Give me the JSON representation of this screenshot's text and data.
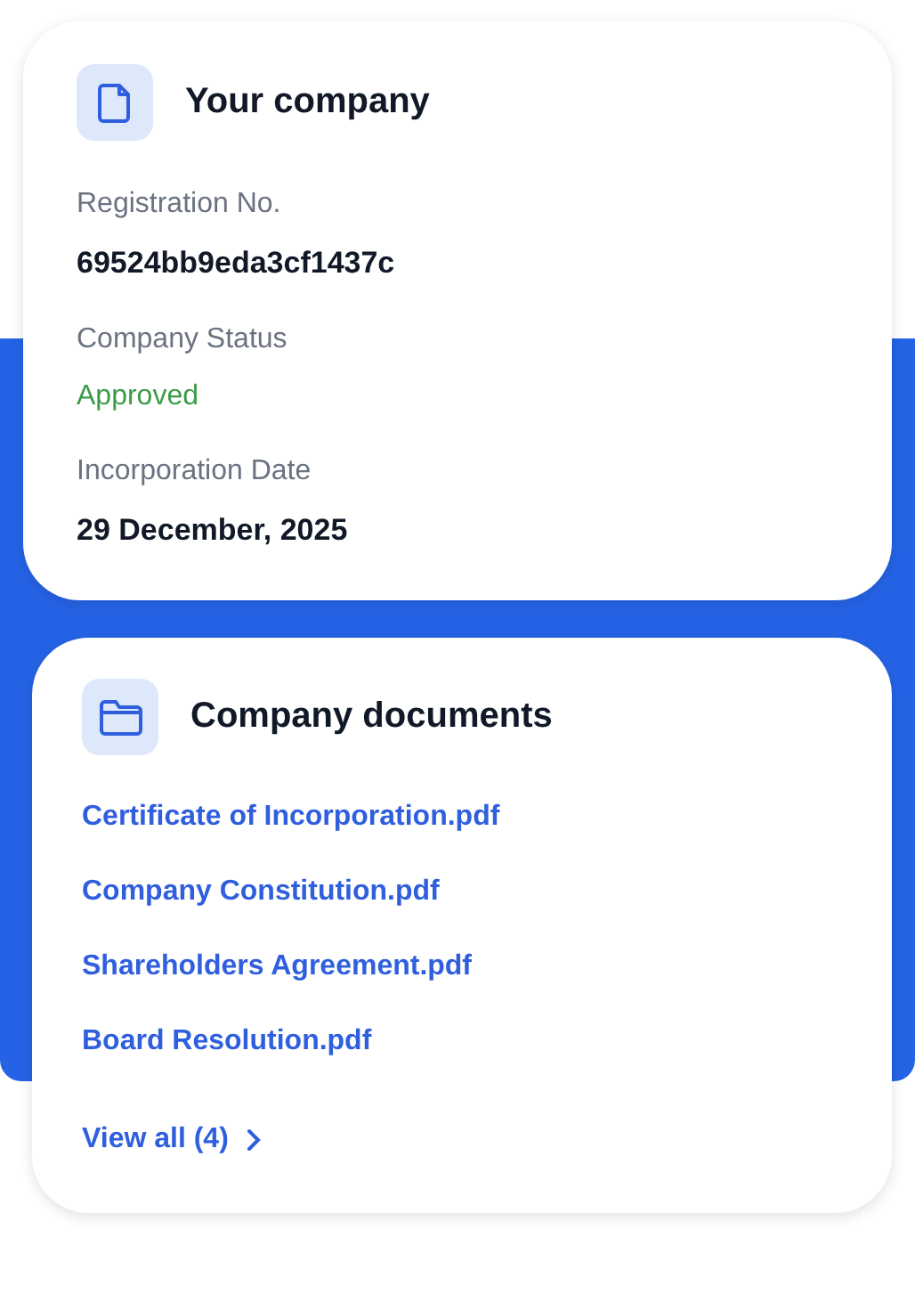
{
  "company_card": {
    "title": "Your company",
    "fields": [
      {
        "label": "Registration No.",
        "value": "69524bb9eda3cf1437c",
        "kind": "text"
      },
      {
        "label": "Company Status",
        "value": "Approved",
        "kind": "status"
      },
      {
        "label": "Incorporation Date",
        "value": "29 December, 2025",
        "kind": "text"
      }
    ]
  },
  "documents_card": {
    "title": "Company documents",
    "documents": [
      "Certificate of Incorporation.pdf",
      "Company Constitution.pdf",
      "Shareholders Agreement.pdf",
      "Board Resolution.pdf"
    ],
    "view_all": "View all (4)"
  }
}
